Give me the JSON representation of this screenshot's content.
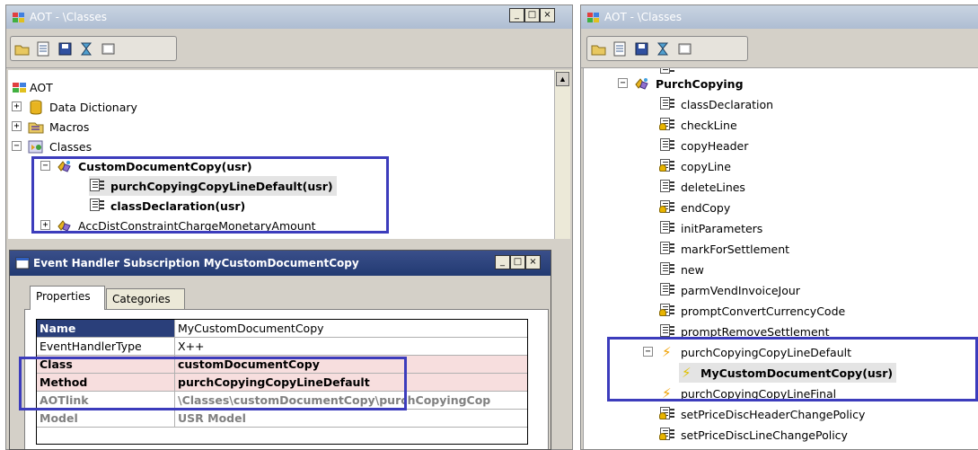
{
  "left_window": {
    "title": "AOT - \\Classes",
    "buttons": [
      "_",
      "□",
      "×"
    ],
    "tree": {
      "root": "AOT",
      "items": [
        {
          "label": "Data Dictionary"
        },
        {
          "label": "Macros"
        },
        {
          "label": "Classes"
        },
        {
          "label": "CustomDocumentCopy(usr)"
        },
        {
          "label": "purchCopyingCopyLineDefault(usr)"
        },
        {
          "label": "classDeclaration(usr)"
        },
        {
          "label": "AccDistConstraintChargeMonetaryAmount"
        }
      ]
    }
  },
  "event_window": {
    "title": "Event Handler Subscription MyCustomDocumentCopy",
    "buttons": [
      "_",
      "□",
      "×"
    ],
    "tabs": [
      "Properties",
      "Categories"
    ],
    "properties": [
      {
        "name": "Name",
        "value": "MyCustomDocumentCopy"
      },
      {
        "name": "EventHandlerType",
        "value": "X++"
      },
      {
        "name": "Class",
        "value": "customDocumentCopy"
      },
      {
        "name": "Method",
        "value": "purchCopyingCopyLineDefault"
      },
      {
        "name": "AOTlink",
        "value": "\\Classes\\customDocumentCopy\\purchCopyingCop"
      },
      {
        "name": "Model",
        "value": "USR Model"
      }
    ]
  },
  "right_window": {
    "title": "AOT - \\Classes",
    "tree": {
      "class": "PurchCopying",
      "methods": [
        "classDeclaration",
        "checkLine",
        "copyHeader",
        "copyLine",
        "deleteLines",
        "endCopy",
        "initParameters",
        "markForSettlement",
        "new",
        "parmVendInvoiceJour",
        "promptConvertCurrencyCode",
        "promptRemoveSettlement",
        "purchCopyingCopyLineDefault",
        "MyCustomDocumentCopy(usr)",
        "purchCopyingCopyLineFinal",
        "setPriceDiscHeaderChangePolicy",
        "setPriceDiscLineChangePolicy"
      ]
    }
  },
  "colors": {
    "title_text": "#ffffff",
    "highlight_box": "#3c3cbc",
    "selected_row": "#f7dede"
  }
}
